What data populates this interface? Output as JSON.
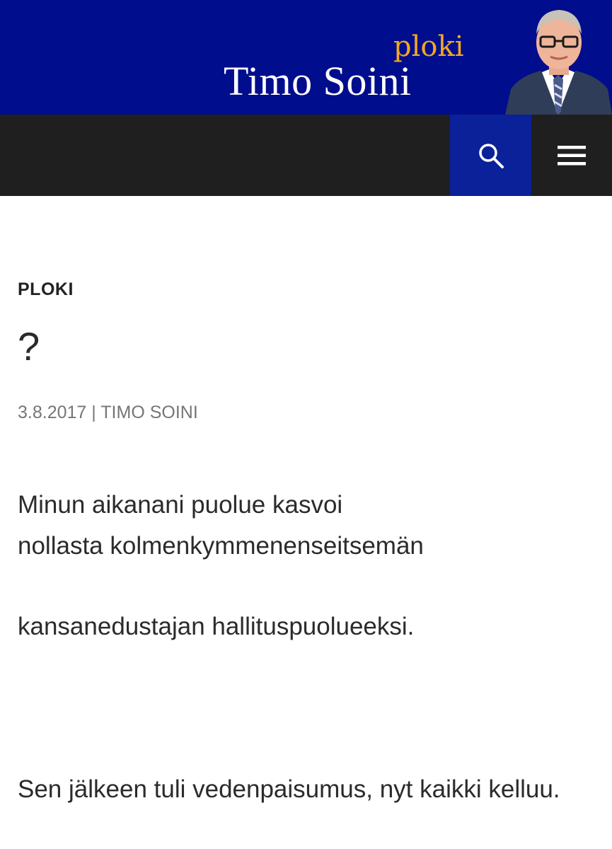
{
  "header": {
    "tagline": "ploki",
    "title": "Timo Soini",
    "colors": {
      "background": "#000d8c",
      "tagline": "#f0a824",
      "title": "#ffffff"
    }
  },
  "nav": {
    "search_icon": "search-icon",
    "menu_icon": "hamburger-menu-icon",
    "colors": {
      "bar": "#1f1f1f",
      "search_button": "#0a2199"
    }
  },
  "post": {
    "category": "PLOKI",
    "title": "?",
    "date": "3.8.2017",
    "separator": "|",
    "author": "TIMO SOINI",
    "paragraphs": [
      "Minun aikanani puolue kasvoi",
      "nollasta kolmenkymmenenseitsemän",
      "kansanedustajan hallituspuolueeksi.",
      "Sen jälkeen tuli vedenpaisumus, nyt kaikki kelluu."
    ]
  }
}
